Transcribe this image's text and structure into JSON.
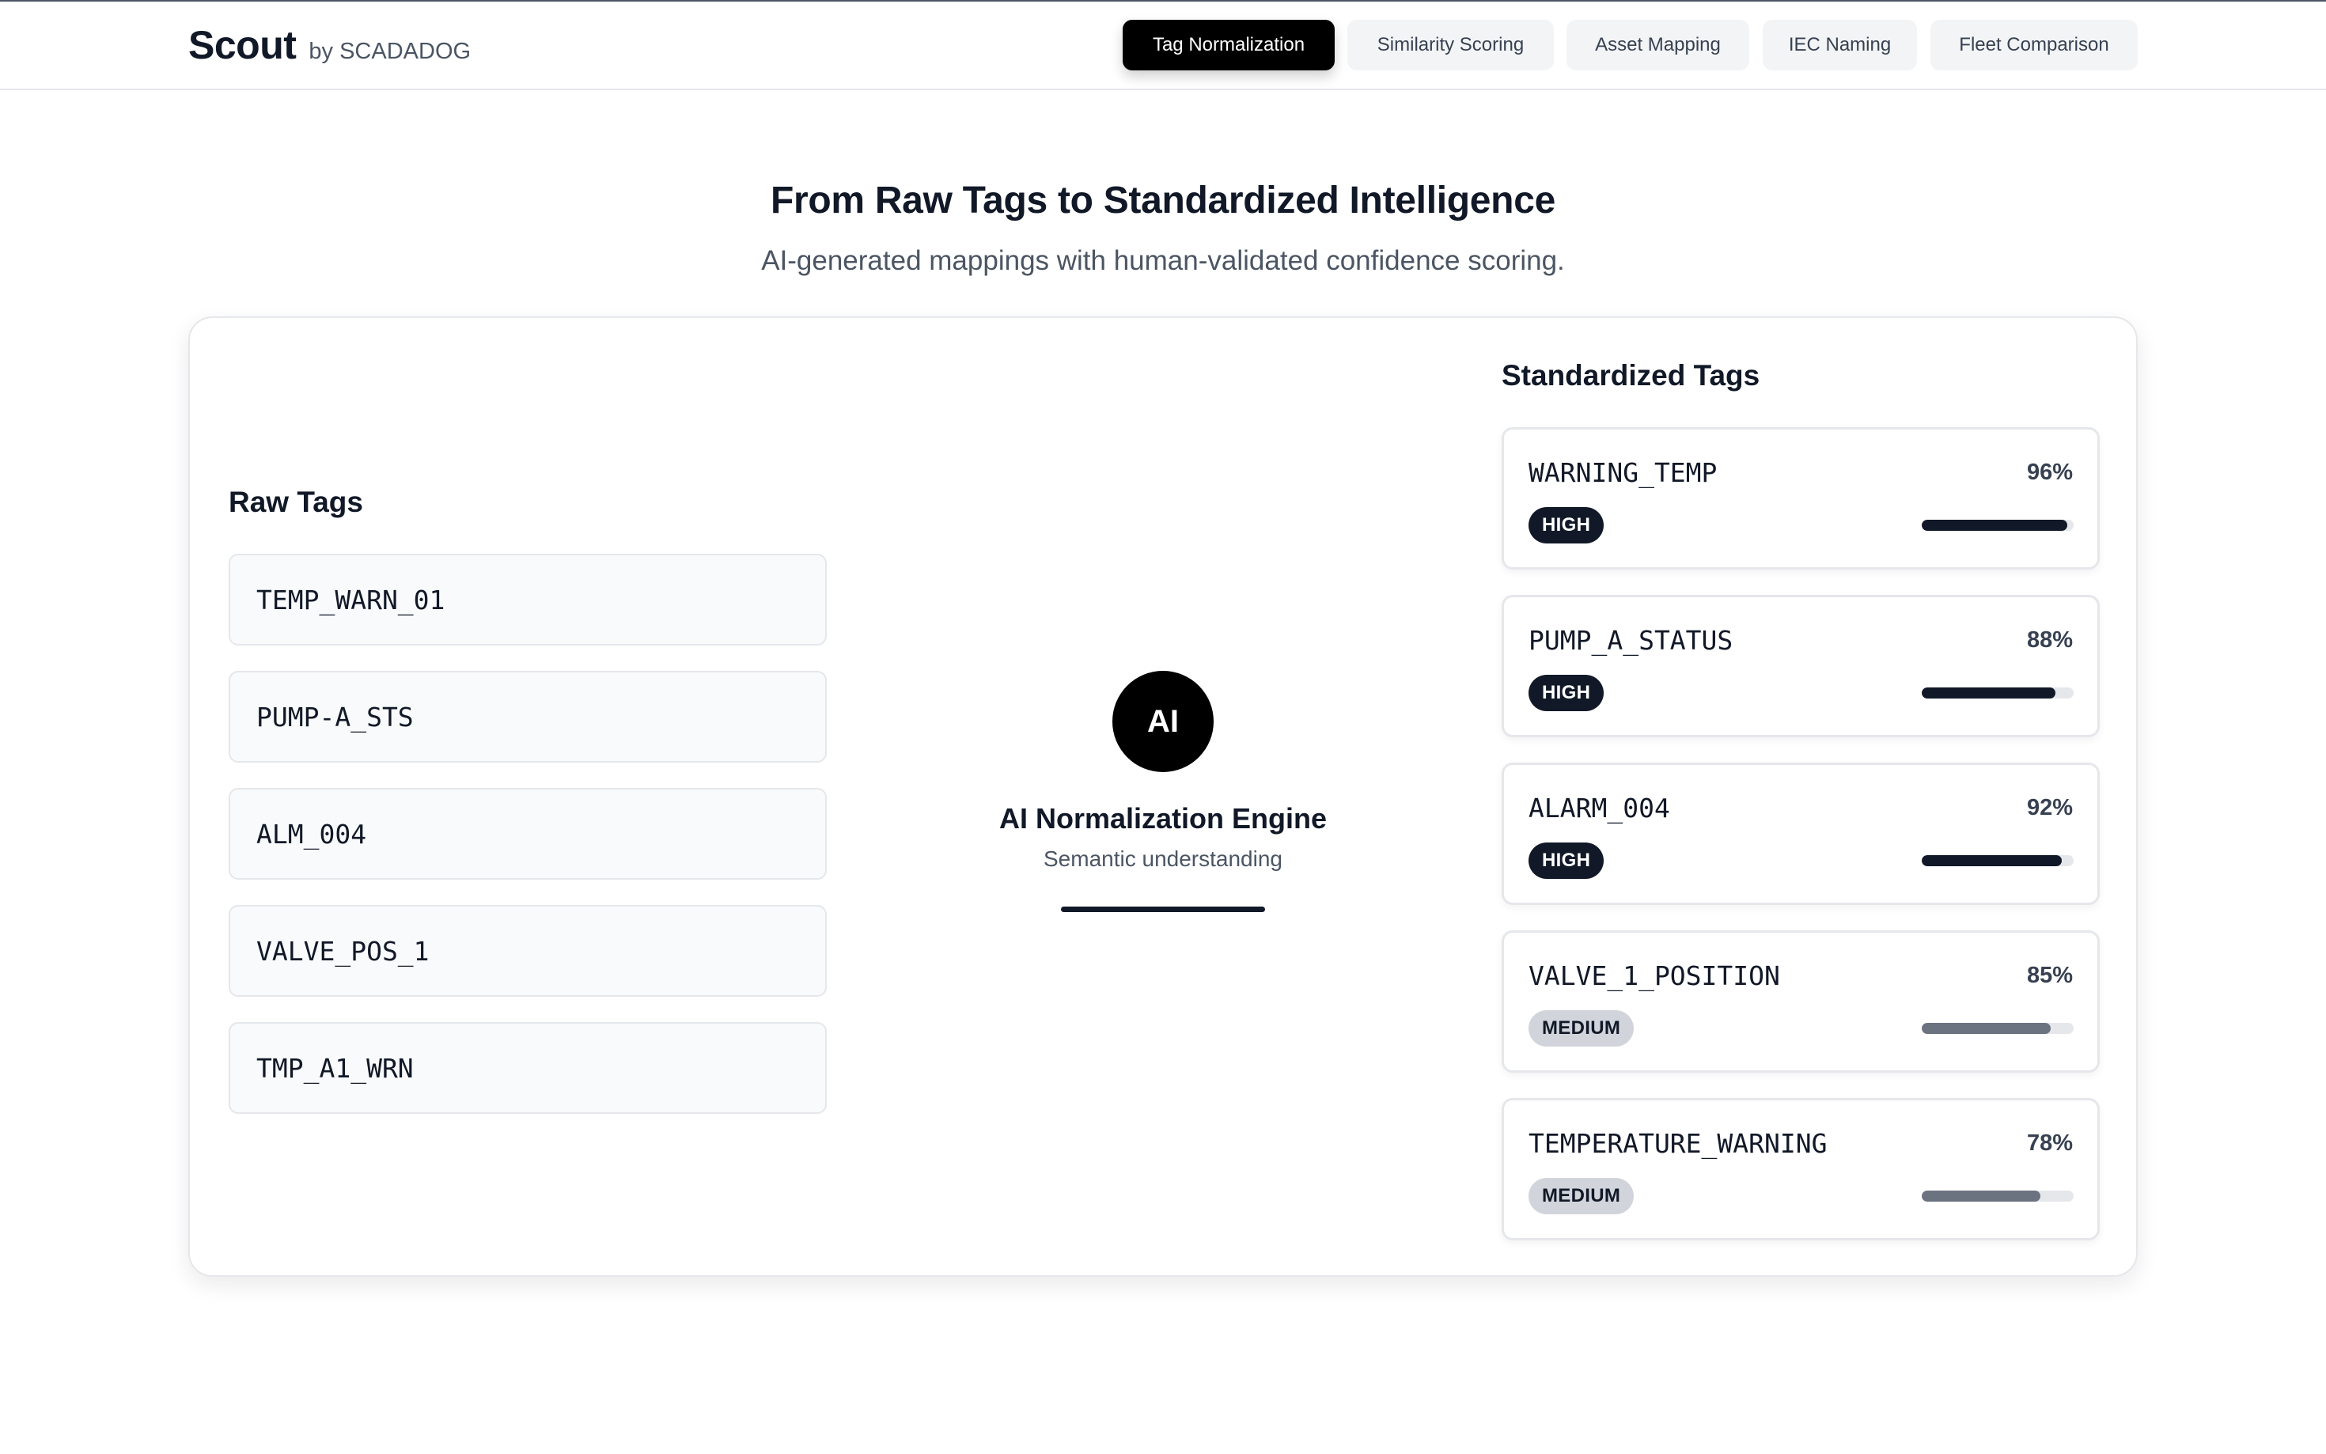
{
  "brand": {
    "name": "Scout",
    "by": "by SCADADOG"
  },
  "nav": {
    "tabs": [
      {
        "label": "Tag Normalization",
        "active": true
      },
      {
        "label": "Similarity Scoring",
        "active": false
      },
      {
        "label": "Asset Mapping",
        "active": false
      },
      {
        "label": "IEC Naming",
        "active": false
      },
      {
        "label": "Fleet Comparison",
        "active": false
      }
    ]
  },
  "hero": {
    "title": "From Raw Tags to Standardized Intelligence",
    "subtitle": "AI-generated mappings with human-validated confidence scoring."
  },
  "raw": {
    "title": "Raw Tags",
    "tags": [
      "TEMP_WARN_01",
      "PUMP-A_STS",
      "ALM_004",
      "VALVE_POS_1",
      "TMP_A1_WRN"
    ]
  },
  "engine": {
    "badge": "AI",
    "title": "AI Normalization Engine",
    "subtitle": "Semantic understanding"
  },
  "standardized": {
    "title": "Standardized Tags",
    "tags": [
      {
        "name": "WARNING_TEMP",
        "percent": "96%",
        "confidence": 0.96,
        "level": "HIGH"
      },
      {
        "name": "PUMP_A_STATUS",
        "percent": "88%",
        "confidence": 0.88,
        "level": "HIGH"
      },
      {
        "name": "ALARM_004",
        "percent": "92%",
        "confidence": 0.92,
        "level": "HIGH"
      },
      {
        "name": "VALVE_1_POSITION",
        "percent": "85%",
        "confidence": 0.85,
        "level": "MEDIUM"
      },
      {
        "name": "TEMPERATURE_WARNING",
        "percent": "78%",
        "confidence": 0.78,
        "level": "MEDIUM"
      }
    ]
  },
  "colors": {
    "accent": "#000000",
    "high": "#111827",
    "medium": "#6b7280",
    "track": "#e5e7eb"
  }
}
